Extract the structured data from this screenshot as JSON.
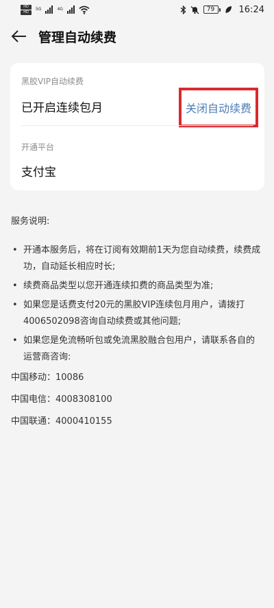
{
  "status_bar": {
    "sim1": "HD",
    "sim2": "HD",
    "net1": "5G",
    "net2": "4G",
    "battery": "79",
    "time": "16:24"
  },
  "header": {
    "back_icon": "arrow-left-icon",
    "title": "管理自动续费"
  },
  "subscription_card": {
    "product_label": "黑胶VIP自动续费",
    "status_text": "已开启连续包月",
    "close_button": "关闭自动续费",
    "platform_label": "开通平台",
    "platform_value": "支付宝"
  },
  "service_notes": {
    "title": "服务说明:",
    "bullet_symbol": "•",
    "items": [
      "开通本服务后，将在订阅有效期前1天为您自动续费，续费成功，自动延长相应时长;",
      "续费商品类型以您开通连续扣费的商品类型为准;",
      "如果您是话费支付20元的黑胶VIP连续包月用户，请拨打4006502098咨询自动续费或其他问题;",
      "如果您是免流畅听包或免流黑胶融合包用户，请联系各自的运营商咨询:"
    ],
    "contacts": [
      "中国移动：10086",
      "中国电信：4008308100",
      "中国联通：4000410155"
    ]
  },
  "colors": {
    "page_background": "#f4f4f5",
    "card_background": "#ffffff",
    "link_blue": "#4b7db8",
    "highlight_red": "#d82a2f"
  }
}
